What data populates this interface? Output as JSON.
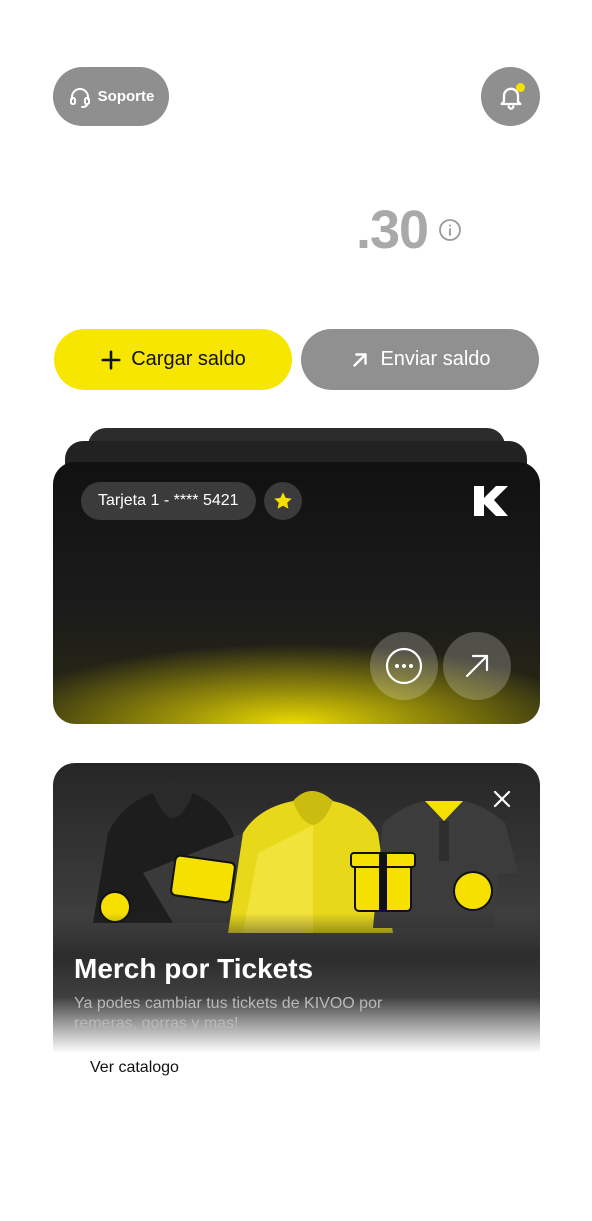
{
  "header": {
    "support_label": "Soporte",
    "support_icon": "headset-icon",
    "notifications_icon": "bell-icon",
    "notification_dot_color": "#f5e000"
  },
  "balance": {
    "value": ".30",
    "info_icon": "info-icon"
  },
  "actions": {
    "load_label": "Cargar saldo",
    "send_label": "Enviar saldo",
    "load_color": "#f7e600",
    "send_color": "#909090"
  },
  "card": {
    "label": "Tarjeta 1 - **** 5421",
    "favorite_icon": "star-icon",
    "brand_icon": "kivoo-logo-icon",
    "actions": [
      "dots-icon",
      "arrow-up-right-icon"
    ],
    "accent_color": "#f5e400"
  },
  "promo": {
    "title": "Merch por Tickets",
    "description": "Ya podes cambiar tus tickets de KIVOO por remeras, gorras y mas!",
    "link_label": "Ver catalogo",
    "close_icon": "close-icon"
  }
}
